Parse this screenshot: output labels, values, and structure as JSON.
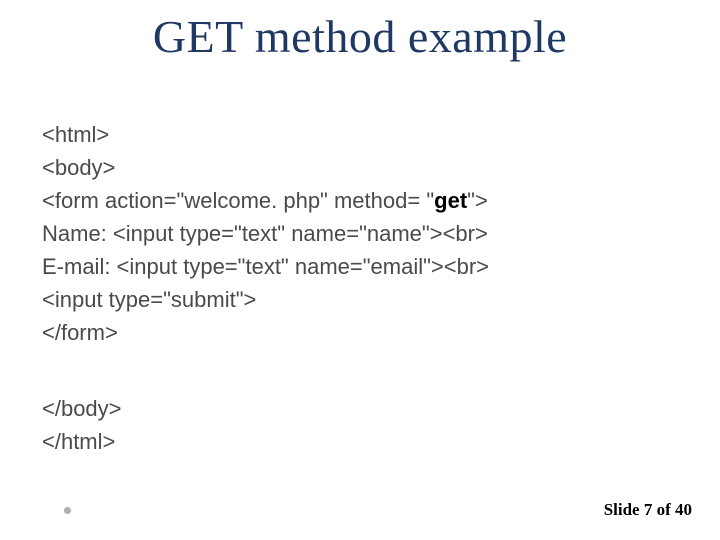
{
  "title": "GET method example",
  "code": {
    "l1": "<html>",
    "l2": "<body>",
    "l3a": "<form action=\"welcome. php\" method= \"",
    "l3b": "get",
    "l3c": "\">",
    "l4": "Name: <input type=\"text\" name=\"name\"><br>",
    "l5": "E-mail: <input type=\"text\" name=\"email\"><br>",
    "l6": "<input type=\"submit\">",
    "l7": "</form>"
  },
  "code2": {
    "l1": "</body>",
    "l2": "</html>"
  },
  "footer": "Slide 7 of 40"
}
